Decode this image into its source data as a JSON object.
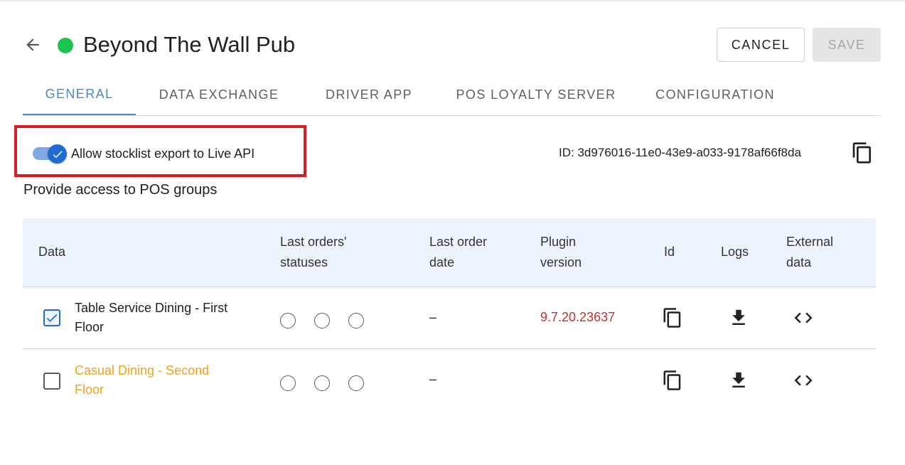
{
  "header": {
    "title": "Beyond The Wall Pub",
    "status_color": "#1ec24f",
    "back_icon": "arrow-left-icon",
    "cancel_label": "CANCEL",
    "save_label": "SAVE"
  },
  "tabs": [
    {
      "label": "GENERAL",
      "active": true
    },
    {
      "label": "DATA EXCHANGE",
      "active": false
    },
    {
      "label": "DRIVER APP",
      "active": false
    },
    {
      "label": "POS LOYALTY SERVER",
      "active": false
    },
    {
      "label": "CONFIGURATION",
      "active": false
    }
  ],
  "general": {
    "toggle_label": "Allow stocklist export to Live API",
    "toggle_on": true,
    "id_text": "ID: 3d976016-11e0-43e9-a033-9178af66f8da",
    "subheading": "Provide access to POS groups"
  },
  "table": {
    "columns": {
      "data": "Data",
      "statuses_l1": "Last orders'",
      "statuses_l2": "statuses",
      "date_l1": "Last order",
      "date_l2": "date",
      "plugin_l1": "Plugin",
      "plugin_l2": "version",
      "id": "Id",
      "logs": "Logs",
      "ext_l1": "External",
      "ext_l2": "data"
    },
    "rows": [
      {
        "name_l1": "Table Service Dining - First",
        "name_l2": "Floor",
        "checked": true,
        "last_order_date": "–",
        "plugin_version": "9.7.20.23637"
      },
      {
        "name_l1": "Casual Dining - Second",
        "name_l2": "Floor",
        "checked": false,
        "last_order_date": "–",
        "plugin_version": ""
      }
    ]
  },
  "colors": {
    "accent": "#4a86c8",
    "highlight_box": "#d71d24",
    "version_text": "#c0342b",
    "warning_text": "#f0a41e"
  }
}
